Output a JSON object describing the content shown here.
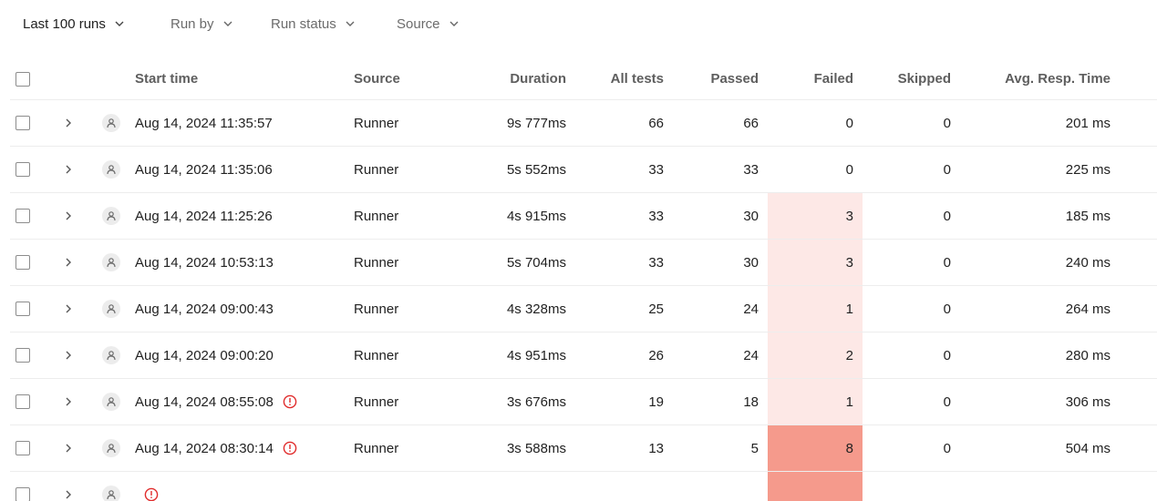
{
  "filters": {
    "range": "Last 100 runs",
    "run_by": "Run by",
    "run_status": "Run status",
    "source": "Source"
  },
  "columns": {
    "start_time": "Start time",
    "source": "Source",
    "duration": "Duration",
    "all_tests": "All tests",
    "passed": "Passed",
    "failed": "Failed",
    "skipped": "Skipped",
    "avg_resp": "Avg. Resp. Time"
  },
  "icons": {
    "expand": "chevron-right-icon",
    "user": "user-icon",
    "warning": "alert-circle-icon",
    "dropdown": "chevron-down-icon"
  },
  "colors": {
    "failed_light": "#fde8e6",
    "failed_strong": "#f59a8c",
    "warning": "#e02b2b"
  },
  "runs": [
    {
      "start_time": "Aug 14, 2024 11:35:57",
      "warning": false,
      "source": "Runner",
      "duration": "9s 777ms",
      "all_tests": "66",
      "passed": "66",
      "failed": "0",
      "skipped": "0",
      "avg_resp": "201 ms",
      "fail_level": "none"
    },
    {
      "start_time": "Aug 14, 2024 11:35:06",
      "warning": false,
      "source": "Runner",
      "duration": "5s 552ms",
      "all_tests": "33",
      "passed": "33",
      "failed": "0",
      "skipped": "0",
      "avg_resp": "225 ms",
      "fail_level": "none"
    },
    {
      "start_time": "Aug 14, 2024 11:25:26",
      "warning": false,
      "source": "Runner",
      "duration": "4s 915ms",
      "all_tests": "33",
      "passed": "30",
      "failed": "3",
      "skipped": "0",
      "avg_resp": "185 ms",
      "fail_level": "light"
    },
    {
      "start_time": "Aug 14, 2024 10:53:13",
      "warning": false,
      "source": "Runner",
      "duration": "5s 704ms",
      "all_tests": "33",
      "passed": "30",
      "failed": "3",
      "skipped": "0",
      "avg_resp": "240 ms",
      "fail_level": "light"
    },
    {
      "start_time": "Aug 14, 2024 09:00:43",
      "warning": false,
      "source": "Runner",
      "duration": "4s 328ms",
      "all_tests": "25",
      "passed": "24",
      "failed": "1",
      "skipped": "0",
      "avg_resp": "264 ms",
      "fail_level": "light"
    },
    {
      "start_time": "Aug 14, 2024 09:00:20",
      "warning": false,
      "source": "Runner",
      "duration": "4s 951ms",
      "all_tests": "26",
      "passed": "24",
      "failed": "2",
      "skipped": "0",
      "avg_resp": "280 ms",
      "fail_level": "light"
    },
    {
      "start_time": "Aug 14, 2024 08:55:08",
      "warning": true,
      "source": "Runner",
      "duration": "3s 676ms",
      "all_tests": "19",
      "passed": "18",
      "failed": "1",
      "skipped": "0",
      "avg_resp": "306 ms",
      "fail_level": "light"
    },
    {
      "start_time": "Aug 14, 2024 08:30:14",
      "warning": true,
      "source": "Runner",
      "duration": "3s 588ms",
      "all_tests": "13",
      "passed": "5",
      "failed": "8",
      "skipped": "0",
      "avg_resp": "504 ms",
      "fail_level": "strong"
    },
    {
      "start_time": "",
      "warning": true,
      "source": "",
      "duration": "",
      "all_tests": "",
      "passed": "",
      "failed": "",
      "skipped": "",
      "avg_resp": "",
      "fail_level": "strong"
    }
  ]
}
